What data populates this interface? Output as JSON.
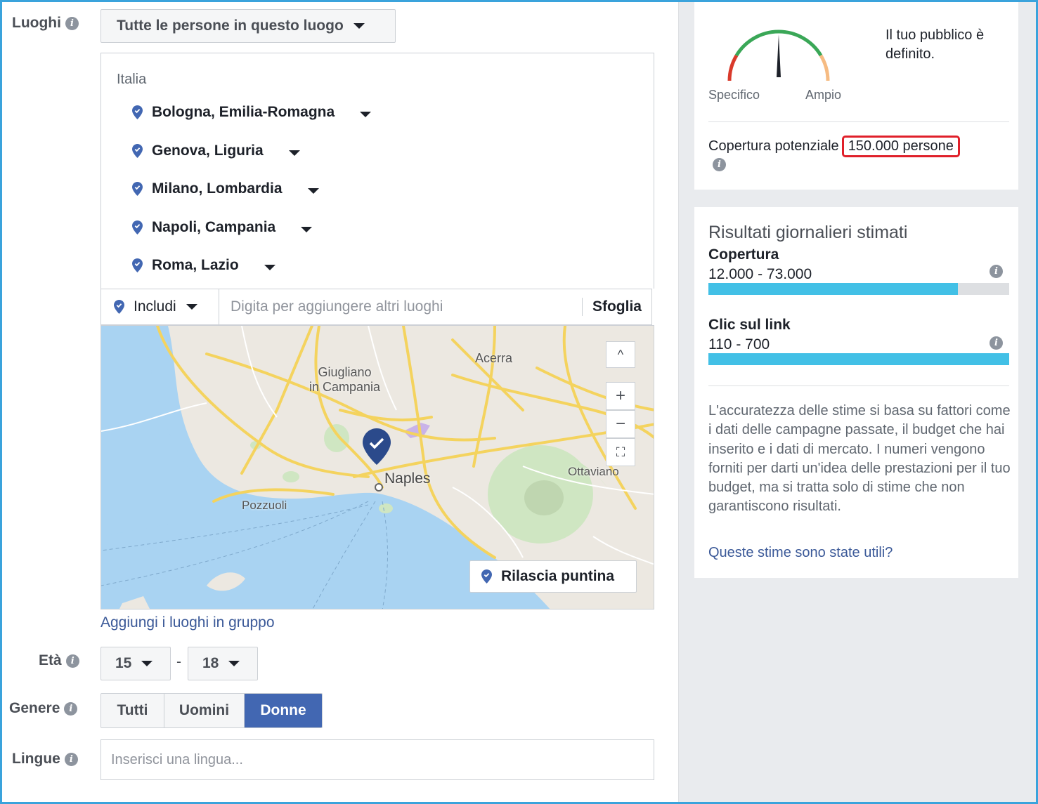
{
  "locations": {
    "label": "Luoghi",
    "scope_button": "Tutte le persone in questo luogo",
    "country": "Italia",
    "items": [
      {
        "name": "Bologna, Emilia-Romagna"
      },
      {
        "name": "Genova, Liguria"
      },
      {
        "name": "Milano, Lombardia"
      },
      {
        "name": "Napoli, Campania"
      },
      {
        "name": "Roma, Lazio"
      }
    ],
    "include_label": "Includi",
    "search_placeholder": "Digita per aggiungere altri luoghi",
    "browse_label": "Sfoglia",
    "drop_pin_label": "Rilascia puntina",
    "group_link": "Aggiungi i luoghi in gruppo"
  },
  "map": {
    "places": [
      "Giugliano",
      "in Campania",
      "Acerra",
      "Naples",
      "Pozzuoli",
      "Ottaviano"
    ],
    "zoom_in": "+",
    "zoom_out": "−",
    "collapse": "^"
  },
  "age": {
    "label": "Età",
    "min": "15",
    "separator": "-",
    "max": "18"
  },
  "gender": {
    "label": "Genere",
    "options": [
      "Tutti",
      "Uomini",
      "Donne"
    ],
    "selected": "Donne"
  },
  "languages": {
    "label": "Lingue",
    "placeholder": "Inserisci una lingua..."
  },
  "audience": {
    "gauge_left": "Specifico",
    "gauge_right": "Ampio",
    "definition": "Il tuo pubblico è definito.",
    "potential_reach_label": "Copertura potenziale",
    "potential_reach_value": "150.000 persone"
  },
  "daily_results": {
    "title": "Risultati giornalieri stimati",
    "reach_label": "Copertura",
    "reach_value": "12.000 - 73.000",
    "reach_fill": 0.83,
    "clicks_label": "Clic sul link",
    "clicks_value": "110 - 700",
    "clicks_fill": 1.0,
    "note": "L'accuratezza delle stime si basa su fattori come i dati delle campagne passate, il budget che hai inserito e i dati di mercato. I numeri vengono forniti per darti un'idea delle prestazioni per il tuo budget, ma si tratta solo di stime che non garantiscono risultati.",
    "feedback_link": "Queste stime sono state utili?"
  },
  "colors": {
    "accent": "#4267b2",
    "bar": "#42c0e6",
    "highlight": "#e0202a",
    "link": "#3b5998"
  }
}
